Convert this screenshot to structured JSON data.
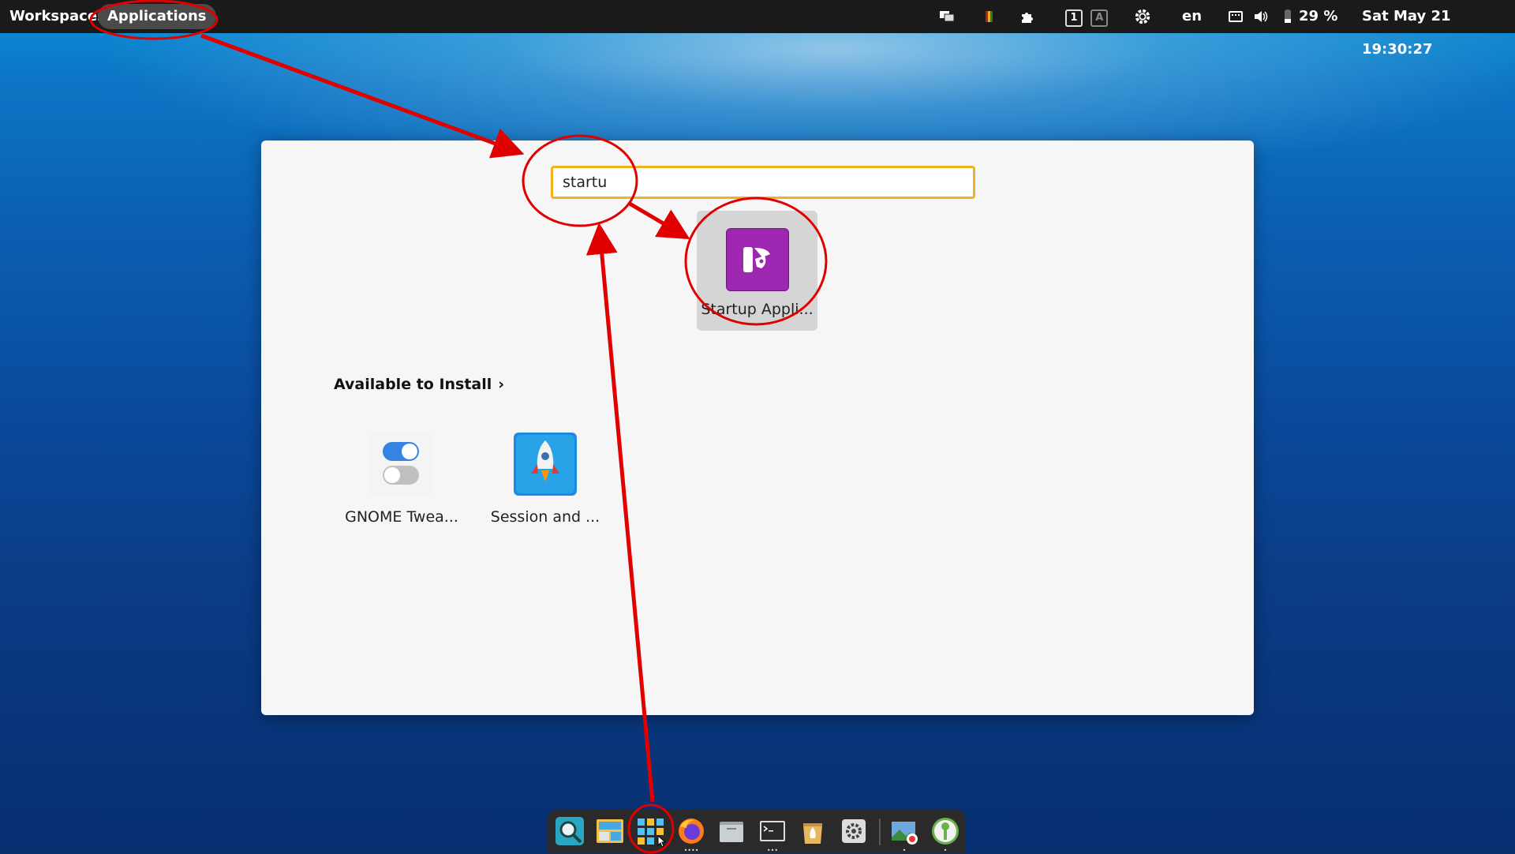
{
  "topbar": {
    "workspaces_label": "Workspaces",
    "applications_label": "Applications",
    "workspace_numbers": [
      "1",
      "A"
    ],
    "language": "en",
    "battery": "29 %",
    "datetime": "Sat May 21  19:30:27"
  },
  "launcher": {
    "search_value": "startu",
    "result": {
      "label": "Startup Appli...",
      "icon": "startup-applications-icon",
      "color": "#9d27b0"
    },
    "available_heading": "Available to Install",
    "available_chevron": "›",
    "install_items": [
      {
        "label": "GNOME Twea...",
        "icon": "gnome-tweaks-icon"
      },
      {
        "label": "Session and ...",
        "icon": "rocket-icon"
      }
    ]
  },
  "dock": {
    "items": [
      "search-icon",
      "workspaces-icon",
      "applications-grid-icon",
      "firefox-icon",
      "files-icon",
      "terminal-icon",
      "pop-shop-icon",
      "settings-icon",
      "image-viewer-icon",
      "keepassxc-icon"
    ]
  },
  "colors": {
    "accent": "#f0b221",
    "annotation": "#e00000",
    "topbar": "#1a1a1a"
  }
}
